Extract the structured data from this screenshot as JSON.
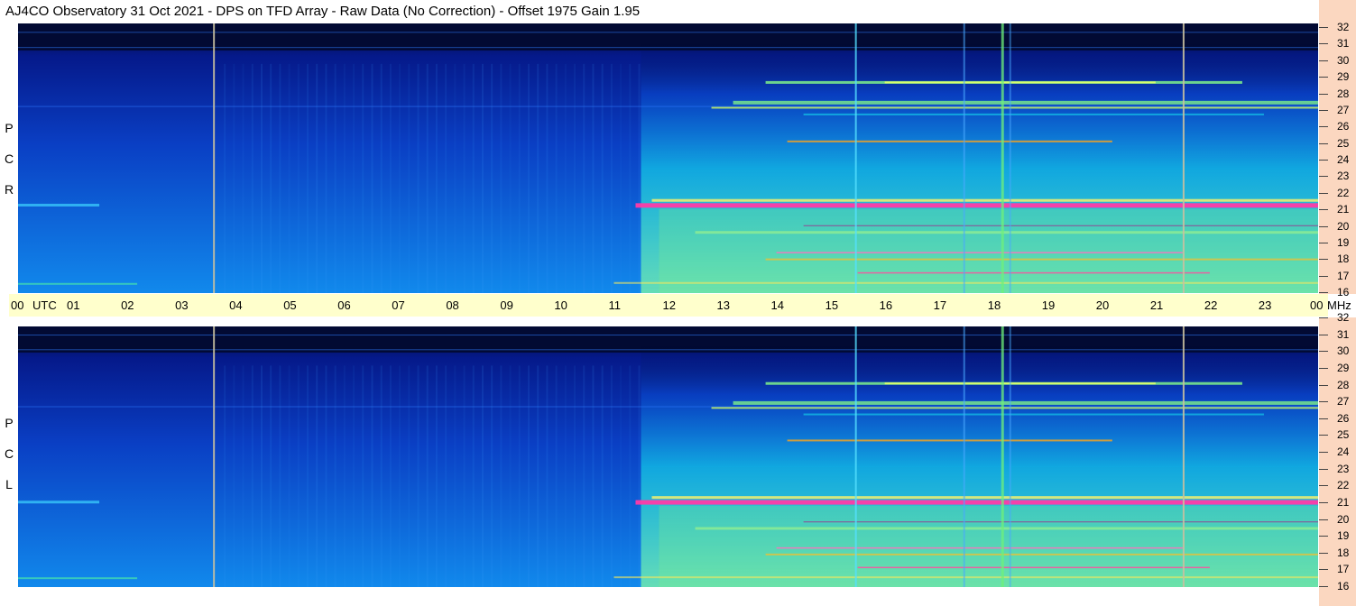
{
  "title": "AJ4CO Observatory  31 Oct 2021  -  DPS on TFD Array  -  Raw Data (No Correction)  -  Offset 1975  Gain 1.95",
  "panels": [
    {
      "id": "rcp",
      "polarization": "R C P",
      "letters": [
        "R",
        "C",
        "P"
      ]
    },
    {
      "id": "lcp",
      "polarization": "L C P",
      "letters": [
        "L",
        "C",
        "P"
      ]
    }
  ],
  "time_axis": {
    "start_label": "00",
    "utc_label": "UTC",
    "labels": [
      "01",
      "02",
      "03",
      "04",
      "05",
      "06",
      "07",
      "08",
      "09",
      "10",
      "11",
      "12",
      "13",
      "14",
      "15",
      "16",
      "17",
      "18",
      "19",
      "20",
      "21",
      "22",
      "23"
    ],
    "end_label": "00",
    "unit_label": "MHz"
  },
  "freq_axis": {
    "labels": [
      "32",
      "31",
      "30",
      "29",
      "28",
      "27",
      "26",
      "25",
      "24",
      "23",
      "22",
      "21",
      "20",
      "19",
      "18",
      "17",
      "16"
    ]
  },
  "colors": {
    "background_dark": "#020a33",
    "quiet_blue": "#0b4fd6",
    "active_cyan": "#13c6e6",
    "active_green": "#7ef08a",
    "strong_magenta": "#ff3aa8",
    "time_strip": "#ffffcc",
    "freq_strip": "#fbd7c0"
  },
  "chart_data": {
    "type": "heatmap",
    "title": "AJ4CO Observatory  31 Oct 2021  -  DPS on TFD Array  -  Raw Data (No Correction)  -  Offset 1975  Gain 1.95",
    "x_unit": "UTC",
    "x_range_hours": [
      0,
      24
    ],
    "y_unit": "MHz",
    "y_range_mhz": [
      16,
      32
    ],
    "series": [
      {
        "name": "R C P"
      },
      {
        "name": "L C P"
      }
    ],
    "features": {
      "persistent_carrier_mhz": 21.2,
      "vertical_marker_hours": [
        3.6,
        21.5
      ],
      "daytime_activity_hours": [
        11.5,
        24
      ]
    }
  }
}
